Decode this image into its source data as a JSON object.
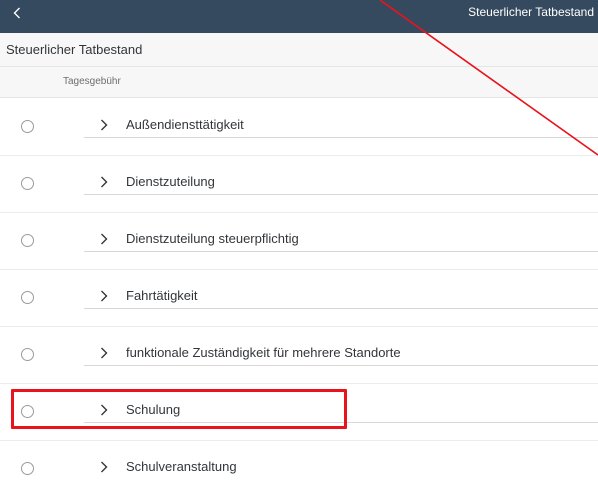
{
  "topbar": {
    "title": "Steuerlicher Tatbestand",
    "back_icon": "chevron-left-icon",
    "background_color": "#354a5f"
  },
  "subheader": {
    "title": "Steuerlicher Tatbestand"
  },
  "group": {
    "label": "Tagesgebühr"
  },
  "items": [
    {
      "label": "Außendiensttätigkeit"
    },
    {
      "label": "Dienstzuteilung"
    },
    {
      "label": "Dienstzuteilung steuerpflichtig"
    },
    {
      "label": "Fahrtätigkeit"
    },
    {
      "label": "funktionale Zuständigkeit für mehrere Standorte"
    },
    {
      "label": "Schulung",
      "highlighted": true
    },
    {
      "label": "Schulveranstaltung"
    }
  ],
  "annotation": {
    "highlight_color": "#e8131c"
  }
}
